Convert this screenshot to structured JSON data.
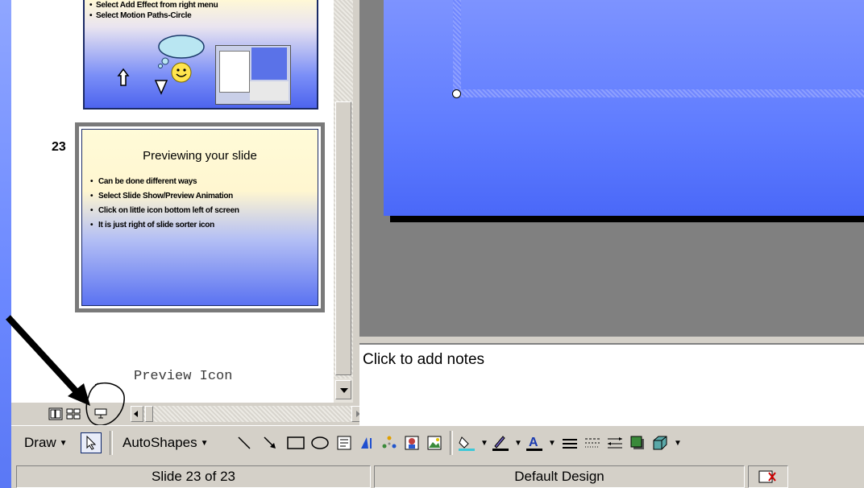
{
  "slide_panel": {
    "prev_slide_bullets": [
      "Select Add Effect from right menu",
      "Select Motion Paths-Circle"
    ],
    "current_slide_number": "23",
    "current_slide": {
      "title": "Previewing your slide",
      "bullets": [
        "Can be done different ways",
        "Select Slide Show/Preview Animation",
        "Click on little icon bottom left of screen",
        "It is just right of slide sorter icon"
      ]
    },
    "annotation_label": "Preview Icon"
  },
  "notes": {
    "placeholder": "Click to add notes"
  },
  "draw_toolbar": {
    "draw_label": "Draw",
    "autoshapes_label": "AutoShapes"
  },
  "status_bar": {
    "slide_info": "Slide 23 of 23",
    "design": "Default Design"
  },
  "colors": {
    "slide_blue": "#5f7cff",
    "panel_gray": "#d4d0c8",
    "edit_gray": "#808080"
  }
}
